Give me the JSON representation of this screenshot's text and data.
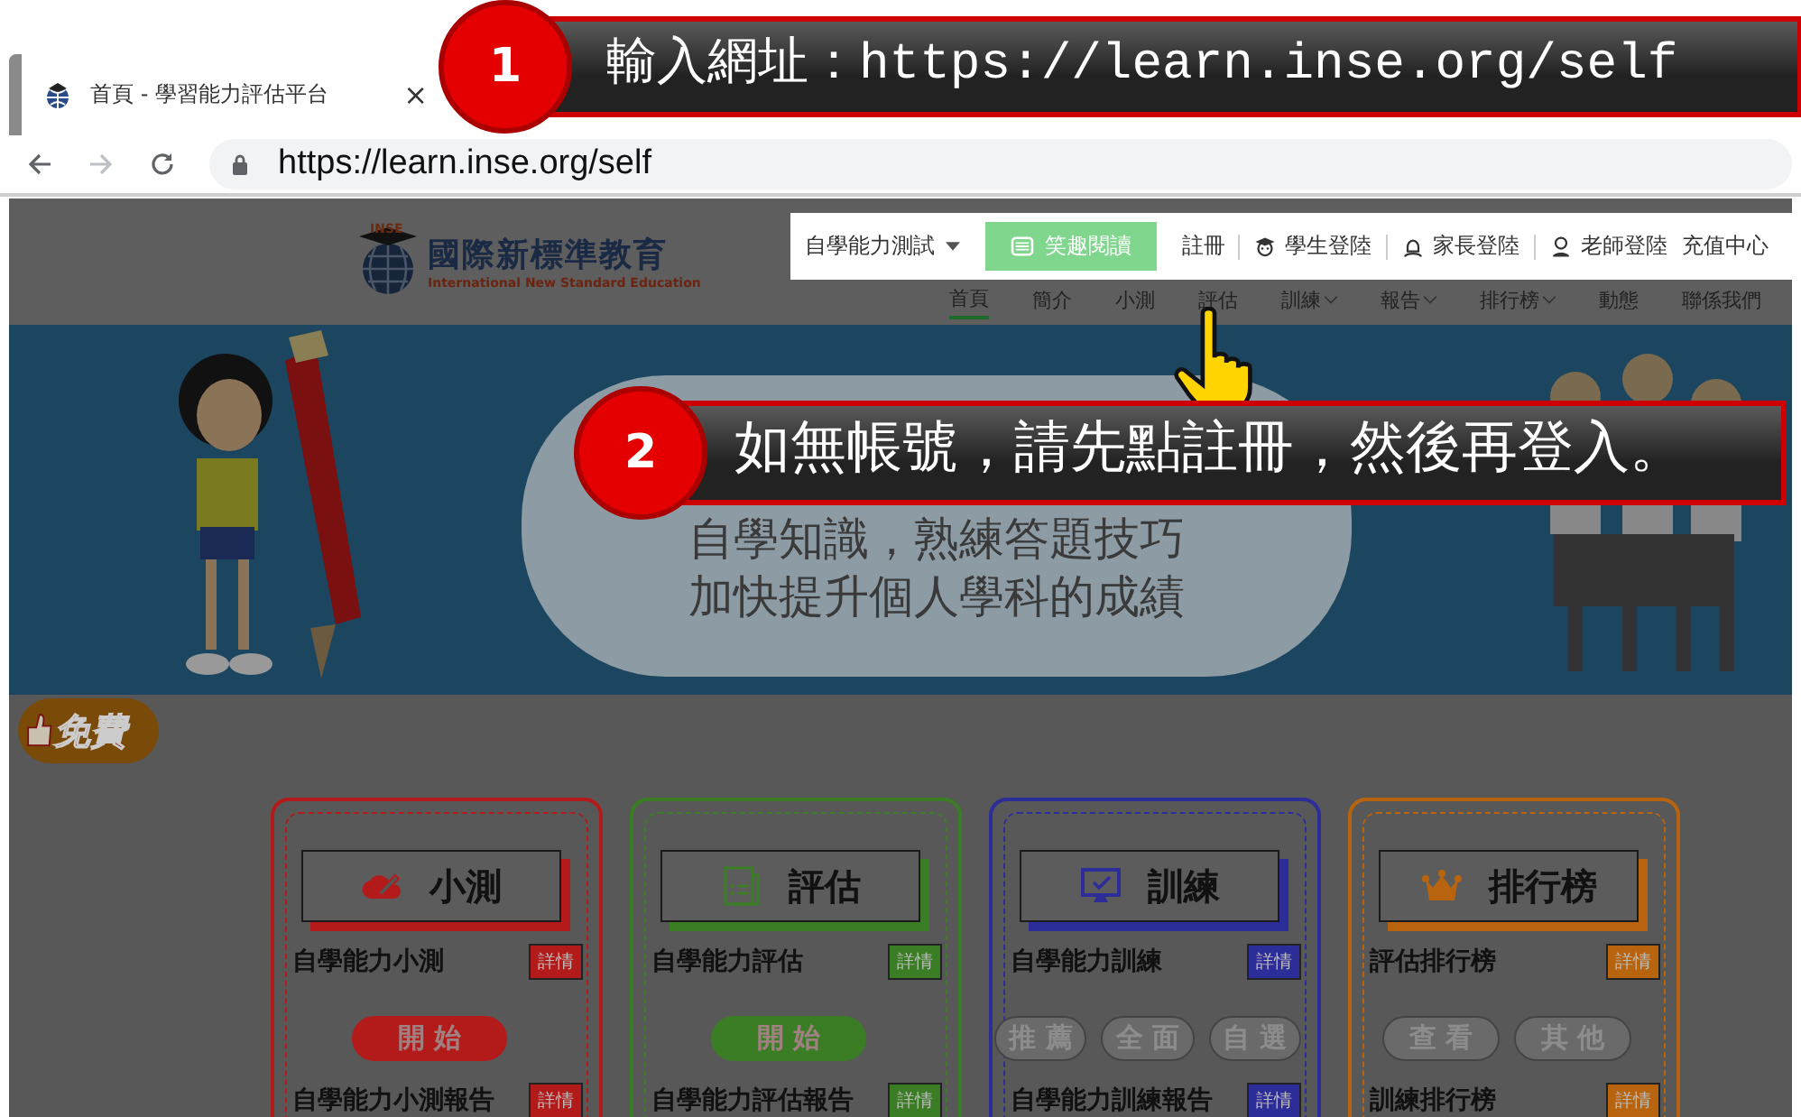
{
  "browser": {
    "tab": {
      "title": "首頁 - 學習能力評估平台",
      "close": "×"
    },
    "address": "https://learn.inse.org/self"
  },
  "header": {
    "logo": {
      "badge": "INSE",
      "name": "國際新標準教育",
      "tagline": "International New Standard Education"
    },
    "top_links": [
      {
        "kind": "dropdown",
        "label": "自學能力測試"
      },
      {
        "kind": "button",
        "label": "笑趣閱讀"
      },
      {
        "kind": "link",
        "label": "註冊"
      },
      {
        "kind": "login",
        "label": "學生登陸"
      },
      {
        "kind": "login",
        "label": "家長登陸"
      },
      {
        "kind": "login",
        "label": "老師登陸"
      },
      {
        "kind": "link",
        "label": "充值中心"
      }
    ],
    "nav": [
      {
        "label": "首頁",
        "selected": true,
        "has_menu": false
      },
      {
        "label": "簡介",
        "selected": false,
        "has_menu": false
      },
      {
        "label": "小測",
        "selected": false,
        "has_menu": false
      },
      {
        "label": "評估",
        "selected": false,
        "has_menu": false
      },
      {
        "label": "訓練",
        "selected": false,
        "has_menu": true
      },
      {
        "label": "報告",
        "selected": false,
        "has_menu": true
      },
      {
        "label": "排行榜",
        "selected": false,
        "has_menu": true
      },
      {
        "label": "動態",
        "selected": false,
        "has_menu": false
      },
      {
        "label": "聯係我們",
        "selected": false,
        "has_menu": false
      }
    ]
  },
  "banner": {
    "lines": [
      "自學知識，熟練答題技巧",
      "加快提升個人學科的成績"
    ]
  },
  "free_badge": "免費",
  "cards": [
    {
      "title": "小測",
      "color": "#b31b1b",
      "rows": [
        {
          "label": "自學能力小測",
          "badge": "詳情"
        },
        {
          "label": "自學能力小測報告",
          "badge": "詳情"
        }
      ],
      "actions": [
        {
          "label": "開 始",
          "disabled": false
        }
      ]
    },
    {
      "title": "評估",
      "color": "#3b7d25",
      "rows": [
        {
          "label": "自學能力評估",
          "badge": "詳情"
        },
        {
          "label": "自學能力評估報告",
          "badge": "詳情"
        }
      ],
      "actions": [
        {
          "label": "開 始",
          "disabled": false
        }
      ]
    },
    {
      "title": "訓練",
      "color": "#2d2d9a",
      "rows": [
        {
          "label": "自學能力訓練",
          "badge": "詳情"
        },
        {
          "label": "自學能力訓練報告",
          "badge": "詳情"
        }
      ],
      "actions": [
        {
          "label": "推 薦",
          "disabled": true
        },
        {
          "label": "全 面",
          "disabled": true
        },
        {
          "label": "自 選",
          "disabled": true
        }
      ]
    },
    {
      "title": "排行榜",
      "color": "#b8640e",
      "rows": [
        {
          "label": "評估排行榜",
          "badge": "詳情"
        },
        {
          "label": "訓練排行榜",
          "badge": "詳情"
        }
      ],
      "actions": [
        {
          "label": "查 看",
          "disabled": true
        },
        {
          "label": "其 他",
          "disabled": true
        }
      ]
    }
  ],
  "callouts": [
    {
      "number": "1",
      "text": "輸入網址：https://learn.inse.org/self"
    },
    {
      "number": "2",
      "text": "如無帳號，請先點註冊，然後再登入。"
    }
  ]
}
